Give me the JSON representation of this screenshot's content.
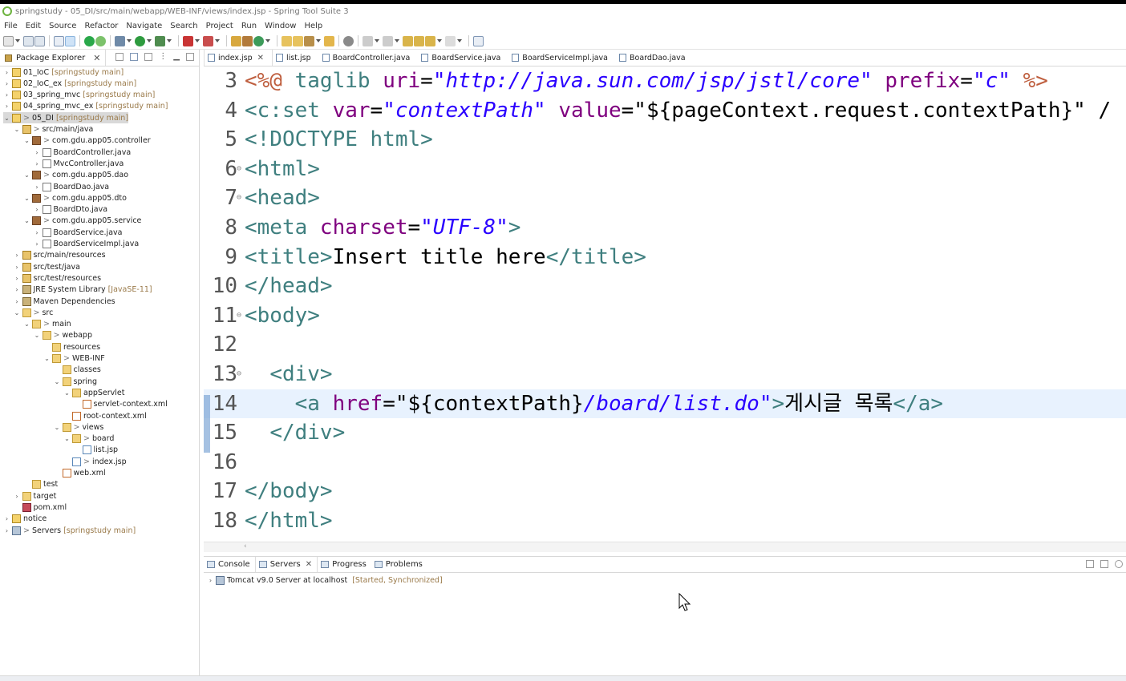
{
  "window": {
    "title": "springstudy - 05_DI/src/main/webapp/WEB-INF/views/index.jsp - Spring Tool Suite 3"
  },
  "menu": [
    "File",
    "Edit",
    "Source",
    "Refactor",
    "Navigate",
    "Search",
    "Project",
    "Run",
    "Window",
    "Help"
  ],
  "package_explorer": {
    "title": "Package Explorer",
    "tree": [
      {
        "label": "01_IoC",
        "suffix": "[springstudy main]",
        "icon": "project-icon",
        "indent": 0,
        "twisty": ">"
      },
      {
        "label": "02_IoC_ex",
        "suffix": "[springstudy main]",
        "icon": "project-icon",
        "indent": 0,
        "twisty": ">"
      },
      {
        "label": "03_spring_mvc",
        "suffix": "[springstudy main]",
        "icon": "project-icon",
        "indent": 0,
        "twisty": ">"
      },
      {
        "label": "04_spring_mvc_ex",
        "suffix": "[springstudy main]",
        "icon": "project-icon",
        "indent": 0,
        "twisty": ">"
      },
      {
        "label": "05_DI",
        "suffix": "[springstudy main]",
        "prefix": ">",
        "icon": "project-icon",
        "indent": 0,
        "twisty": "v",
        "selected": true
      },
      {
        "label": "src/main/java",
        "prefix": ">",
        "icon": "src-folder-icon",
        "indent": 1,
        "twisty": "v"
      },
      {
        "label": "com.gdu.app05.controller",
        "prefix": ">",
        "icon": "package-icon",
        "indent": 2,
        "twisty": "v"
      },
      {
        "label": "BoardController.java",
        "icon": "java-file-icon",
        "indent": 3,
        "twisty": ">"
      },
      {
        "label": "MvcController.java",
        "icon": "java-file-icon",
        "indent": 3,
        "twisty": ">"
      },
      {
        "label": "com.gdu.app05.dao",
        "prefix": ">",
        "icon": "package-icon",
        "indent": 2,
        "twisty": "v"
      },
      {
        "label": "BoardDao.java",
        "icon": "java-file-icon",
        "indent": 3,
        "twisty": ">"
      },
      {
        "label": "com.gdu.app05.dto",
        "prefix": ">",
        "icon": "package-icon",
        "indent": 2,
        "twisty": "v"
      },
      {
        "label": "BoardDto.java",
        "icon": "java-file-icon",
        "indent": 3,
        "twisty": ">"
      },
      {
        "label": "com.gdu.app05.service",
        "prefix": ">",
        "icon": "package-icon",
        "indent": 2,
        "twisty": "v"
      },
      {
        "label": "BoardService.java",
        "icon": "java-file-icon",
        "indent": 3,
        "twisty": ">"
      },
      {
        "label": "BoardServiceImpl.java",
        "icon": "java-file-icon",
        "indent": 3,
        "twisty": ">"
      },
      {
        "label": "src/main/resources",
        "icon": "src-folder-icon",
        "indent": 1,
        "twisty": ">"
      },
      {
        "label": "src/test/java",
        "icon": "src-folder-icon",
        "indent": 1,
        "twisty": ">"
      },
      {
        "label": "src/test/resources",
        "icon": "src-folder-icon",
        "indent": 1,
        "twisty": ">"
      },
      {
        "label": "JRE System Library",
        "suffix": "[JavaSE-11]",
        "icon": "library-icon",
        "indent": 1,
        "twisty": ">"
      },
      {
        "label": "Maven Dependencies",
        "icon": "library-icon",
        "indent": 1,
        "twisty": ">"
      },
      {
        "label": "src",
        "prefix": ">",
        "icon": "folder-icon",
        "indent": 1,
        "twisty": "v"
      },
      {
        "label": "main",
        "prefix": ">",
        "icon": "folder-icon",
        "indent": 2,
        "twisty": "v"
      },
      {
        "label": "webapp",
        "prefix": ">",
        "icon": "folder-icon",
        "indent": 3,
        "twisty": "v"
      },
      {
        "label": "resources",
        "icon": "folder-icon",
        "indent": 4,
        "twisty": ""
      },
      {
        "label": "WEB-INF",
        "prefix": ">",
        "icon": "folder-icon",
        "indent": 4,
        "twisty": "v"
      },
      {
        "label": "classes",
        "icon": "folder-icon",
        "indent": 5,
        "twisty": ""
      },
      {
        "label": "spring",
        "icon": "folder-icon",
        "indent": 5,
        "twisty": "v"
      },
      {
        "label": "appServlet",
        "icon": "folder-icon",
        "indent": 6,
        "twisty": "v"
      },
      {
        "label": "servlet-context.xml",
        "icon": "xml-file-icon",
        "indent": 7,
        "twisty": ""
      },
      {
        "label": "root-context.xml",
        "icon": "xml-file-icon",
        "indent": 6,
        "twisty": ""
      },
      {
        "label": "views",
        "prefix": ">",
        "icon": "folder-icon",
        "indent": 5,
        "twisty": "v"
      },
      {
        "label": "board",
        "prefix": ">",
        "icon": "folder-icon",
        "indent": 6,
        "twisty": "v"
      },
      {
        "label": "list.jsp",
        "icon": "jsp-file-icon",
        "indent": 7,
        "twisty": ""
      },
      {
        "label": "index.jsp",
        "prefix": ">",
        "icon": "jsp-file-icon",
        "indent": 6,
        "twisty": ""
      },
      {
        "label": "web.xml",
        "icon": "xml-file-icon",
        "indent": 5,
        "twisty": ""
      },
      {
        "label": "test",
        "icon": "folder-icon",
        "indent": 2,
        "twisty": ""
      },
      {
        "label": "target",
        "icon": "folder-icon",
        "indent": 1,
        "twisty": ">"
      },
      {
        "label": "pom.xml",
        "icon": "maven-icon",
        "indent": 1,
        "twisty": ""
      },
      {
        "label": "notice",
        "icon": "project-icon",
        "indent": 0,
        "twisty": ">"
      },
      {
        "label": "Servers",
        "suffix": "[springstudy main]",
        "prefix": ">",
        "icon": "server-icon",
        "indent": 0,
        "twisty": ">"
      }
    ]
  },
  "editor_tabs": [
    {
      "label": "index.jsp",
      "active": true,
      "closable": true
    },
    {
      "label": "list.jsp"
    },
    {
      "label": "BoardController.java"
    },
    {
      "label": "BoardService.java"
    },
    {
      "label": "BoardServiceImpl.java"
    },
    {
      "label": "BoardDao.java"
    }
  ],
  "code": [
    {
      "n": "3",
      "fold": "",
      "tokens": [
        [
          "dir",
          "<%@ "
        ],
        [
          "tag",
          "taglib "
        ],
        [
          "attr",
          "uri"
        ],
        [
          "plain",
          "="
        ],
        [
          "str",
          "\"http://java.sun.com/jsp/jstl/core\""
        ],
        [
          "plain",
          " "
        ],
        [
          "attr",
          "prefix"
        ],
        [
          "plain",
          "="
        ],
        [
          "str",
          "\"c\""
        ],
        [
          "plain",
          " "
        ],
        [
          "dir",
          "%>"
        ]
      ]
    },
    {
      "n": "4",
      "fold": "",
      "tokens": [
        [
          "tag",
          "<c:set "
        ],
        [
          "attr",
          "var"
        ],
        [
          "plain",
          "="
        ],
        [
          "str",
          "\"contextPath\""
        ],
        [
          "plain",
          " "
        ],
        [
          "attr",
          "value"
        ],
        [
          "plain",
          "="
        ],
        [
          "plain",
          "\"${pageContext.request.contextPath}\" /"
        ]
      ]
    },
    {
      "n": "5",
      "fold": "",
      "tokens": [
        [
          "tag",
          "<!DOCTYPE html>"
        ]
      ]
    },
    {
      "n": "6",
      "fold": "⊖",
      "tokens": [
        [
          "tag",
          "<html>"
        ]
      ]
    },
    {
      "n": "7",
      "fold": "⊖",
      "tokens": [
        [
          "tag",
          "<head>"
        ]
      ]
    },
    {
      "n": "8",
      "fold": "",
      "tokens": [
        [
          "tag",
          "<meta "
        ],
        [
          "attr",
          "charset"
        ],
        [
          "plain",
          "="
        ],
        [
          "str",
          "\"UTF-8\""
        ],
        [
          "tag",
          ">"
        ]
      ]
    },
    {
      "n": "9",
      "fold": "",
      "tokens": [
        [
          "tag",
          "<title>"
        ],
        [
          "plain",
          "Insert title here"
        ],
        [
          "tag",
          "</title>"
        ]
      ]
    },
    {
      "n": "10",
      "fold": "",
      "tokens": [
        [
          "tag",
          "</head>"
        ]
      ]
    },
    {
      "n": "11",
      "fold": "⊖",
      "tokens": [
        [
          "tag",
          "<body>"
        ]
      ]
    },
    {
      "n": "12",
      "fold": "",
      "tokens": []
    },
    {
      "n": "13",
      "fold": "⊖",
      "tokens": [
        [
          "plain",
          "  "
        ],
        [
          "tag",
          "<div>"
        ]
      ]
    },
    {
      "n": "14",
      "fold": "",
      "current": true,
      "tokens": [
        [
          "plain",
          "    "
        ],
        [
          "tag",
          "<a "
        ],
        [
          "attr",
          "href"
        ],
        [
          "plain",
          "="
        ],
        [
          "plain",
          "\"${contextPath}"
        ],
        [
          "str",
          "/board/list.do\""
        ],
        [
          "tag",
          ">"
        ],
        [
          "plain",
          "게시글 목록"
        ],
        [
          "tag",
          "</a>"
        ]
      ]
    },
    {
      "n": "15",
      "fold": "",
      "tokens": [
        [
          "plain",
          "  "
        ],
        [
          "tag",
          "</div>"
        ]
      ]
    },
    {
      "n": "16",
      "fold": "",
      "tokens": []
    },
    {
      "n": "17",
      "fold": "",
      "tokens": [
        [
          "tag",
          "</body>"
        ]
      ]
    },
    {
      "n": "18",
      "fold": "",
      "tokens": [
        [
          "tag",
          "</html>"
        ]
      ]
    }
  ],
  "bottom_panel": {
    "tabs": [
      {
        "label": "Console"
      },
      {
        "label": "Servers",
        "active": true,
        "closable": true
      },
      {
        "label": "Progress"
      },
      {
        "label": "Problems"
      }
    ],
    "server": {
      "name": "Tomcat v9.0 Server at localhost",
      "status": "[Started, Synchronized]"
    }
  },
  "colors": {
    "tag": "#3f7f7f",
    "attr": "#7f007f",
    "string": "#2a00ff",
    "directive": "#bf5f3f",
    "current_line": "#e8f2fe",
    "selection": "#d9d9d9"
  }
}
